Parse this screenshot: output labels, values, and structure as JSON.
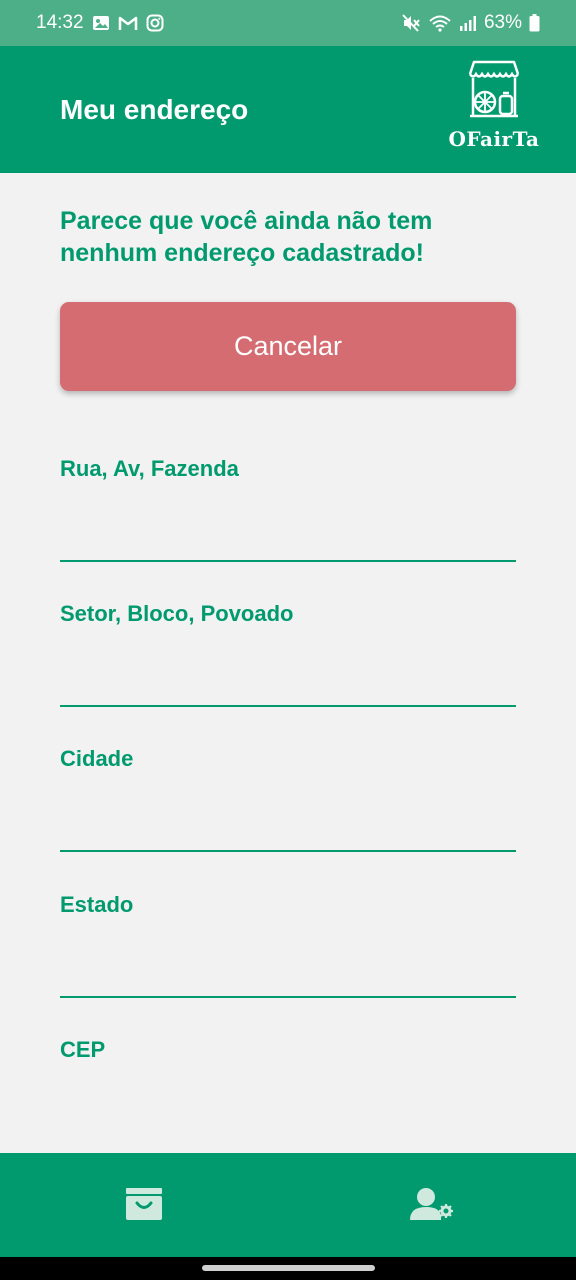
{
  "status_bar": {
    "time": "14:32",
    "battery": "63%",
    "left_icons": [
      "gallery-icon",
      "gmail-icon",
      "instagram-icon"
    ],
    "right_icons": [
      "mute-icon",
      "wifi-icon",
      "signal-icon",
      "battery-icon"
    ]
  },
  "header": {
    "title": "Meu endereço",
    "logo_text": "OFairTa"
  },
  "notice": "Parece que você ainda não tem nenhum endereço cadastrado!",
  "cancel_button": "Cancelar",
  "form": {
    "fields": [
      {
        "label": "Rua, Av, Fazenda",
        "value": ""
      },
      {
        "label": "Setor, Bloco, Povoado",
        "value": ""
      },
      {
        "label": "Cidade",
        "value": ""
      },
      {
        "label": "Estado",
        "value": ""
      },
      {
        "label": "CEP",
        "value": ""
      }
    ]
  },
  "bottom_nav": {
    "items": [
      {
        "icon": "shopping-bag-icon"
      },
      {
        "icon": "user-settings-icon"
      }
    ]
  },
  "colors": {
    "primary": "#009a6e",
    "status_bar": "#4daf87",
    "cancel": "#d46c72",
    "background": "#f2f2f2"
  }
}
